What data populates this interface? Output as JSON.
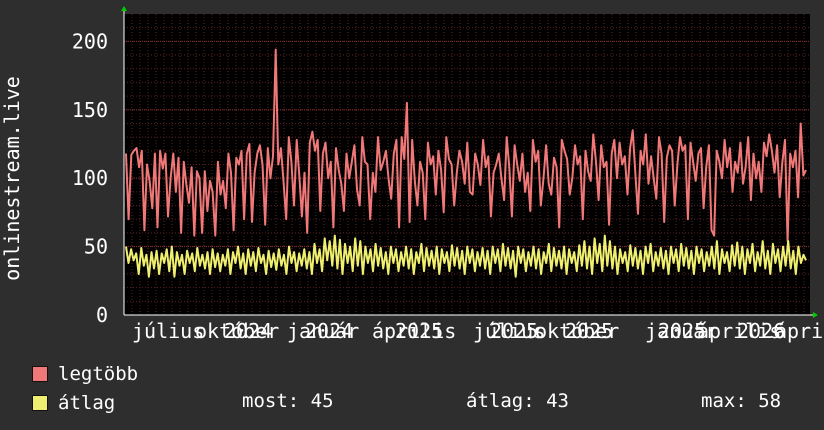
{
  "chart_data": {
    "type": "line",
    "ylabel": "onlinestream.live",
    "ylim": [
      0,
      220
    ],
    "y_ticks": [
      0,
      50,
      100,
      150,
      200
    ],
    "x_tick_labels": [
      "július",
      "október",
      "2024",
      "január",
      "2024",
      "április",
      "2025",
      "július",
      "2025",
      "október",
      "2025",
      "január",
      "2025",
      "április",
      "2026",
      "április"
    ],
    "grid": true,
    "legend_position": "bottom-left",
    "colors": {
      "background": "#2e2e2e",
      "plot_area": "#000000",
      "grid": "#5a2020",
      "axis": "#ffffff",
      "text": "#ffffff",
      "legtobb": "#f07878",
      "atlag": "#f0f070"
    },
    "series": [
      {
        "name": "legtöbb",
        "values": [
          118,
          70,
          117,
          120,
          122,
          108,
          120,
          62,
          110,
          98,
          78,
          118,
          64,
          120,
          107,
          118,
          72,
          100,
          118,
          90,
          115,
          60,
          112,
          95,
          82,
          108,
          58,
          105,
          100,
          60,
          105,
          76,
          98,
          90,
          58,
          112,
          88,
          98,
          78,
          118,
          104,
          62,
          115,
          110,
          120,
          70,
          118,
          125,
          68,
          104,
          118,
          124,
          110,
          66,
          122,
          100,
          116,
          194,
          110,
          122,
          98,
          70,
          130,
          112,
          80,
          128,
          102,
          72,
          104,
          60,
          126,
          134,
          120,
          128,
          76,
          118,
          126,
          100,
          112,
          64,
          122,
          106,
          96,
          76,
          118,
          100,
          112,
          124,
          92,
          80,
          130,
          112,
          110,
          70,
          104,
          90,
          130,
          106,
          112,
          120,
          100,
          85,
          118,
          128,
          64,
          130,
          114,
          155,
          68,
          128,
          98,
          80,
          112,
          104,
          70,
          126,
          110,
          116,
          88,
          120,
          106,
          75,
          130,
          114,
          110,
          80,
          104,
          120,
          112,
          96,
          126,
          90,
          88,
          118,
          110,
          95,
          128,
          108,
          116,
          72,
          104,
          110,
          118,
          100,
          84,
          130,
          108,
          72,
          124,
          110,
          98,
          118,
          90,
          104,
          76,
          128,
          112,
          120,
          80,
          100,
          124,
          96,
          88,
          115,
          108,
          64,
          128,
          120,
          114,
          88,
          100,
          124,
          110,
          116,
          70,
          120,
          105,
          98,
          132,
          112,
          84,
          124,
          108,
          112,
          66,
          118,
          128,
          100,
          126,
          110,
          116,
          88,
          122,
          135,
          104,
          74,
          120,
          110,
          132,
          96,
          116,
          100,
          85,
          130,
          118,
          68,
          115,
          124,
          120,
          80,
          110,
          130,
          120,
          124,
          70,
          126,
          112,
          98,
          118,
          122,
          78,
          108,
          124,
          62,
          58,
          120,
          112,
          100,
          128,
          108,
          122,
          90,
          112,
          104,
          126,
          96,
          108,
          130,
          84,
          118,
          100,
          112,
          90,
          126,
          116,
          132,
          120,
          104,
          124,
          86,
          112,
          128,
          54,
          118,
          108,
          120,
          86,
          140,
          102,
          106
        ]
      },
      {
        "name": "átlag",
        "values": [
          50,
          38,
          48,
          40,
          45,
          30,
          49,
          36,
          44,
          28,
          46,
          34,
          47,
          30,
          45,
          38,
          48,
          32,
          50,
          28,
          46,
          36,
          44,
          30,
          47,
          38,
          45,
          32,
          49,
          36,
          44,
          34,
          46,
          30,
          48,
          35,
          45,
          32,
          44,
          36,
          48,
          30,
          46,
          38,
          50,
          34,
          45,
          30,
          48,
          36,
          46,
          32,
          49,
          38,
          44,
          30,
          47,
          35,
          45,
          33,
          48,
          36,
          44,
          30,
          50,
          38,
          46,
          32,
          45,
          36,
          48,
          34,
          46,
          30,
          52,
          38,
          48,
          32,
          56,
          40,
          54,
          36,
          58,
          34,
          55,
          30,
          52,
          38,
          50,
          32,
          56,
          36,
          54,
          30,
          50,
          38,
          48,
          32,
          52,
          36,
          49,
          34,
          46,
          30,
          50,
          38,
          48,
          32,
          46,
          36,
          50,
          34,
          48,
          30,
          46,
          38,
          52,
          32,
          49,
          36,
          47,
          34,
          50,
          30,
          48,
          38,
          46,
          32,
          51,
          36,
          49,
          34,
          47,
          30,
          50,
          38,
          48,
          32,
          46,
          36,
          49,
          34,
          47,
          30,
          50,
          38,
          48,
          32,
          52,
          36,
          49,
          34,
          47,
          28,
          50,
          38,
          48,
          32,
          46,
          36,
          50,
          34,
          48,
          30,
          46,
          38,
          52,
          32,
          49,
          36,
          47,
          34,
          50,
          30,
          48,
          38,
          46,
          32,
          51,
          36,
          54,
          34,
          50,
          30,
          56,
          38,
          52,
          32,
          58,
          36,
          54,
          34,
          50,
          30,
          48,
          38,
          46,
          32,
          51,
          36,
          49,
          34,
          47,
          30,
          50,
          38,
          52,
          32,
          46,
          36,
          49,
          34,
          47,
          30,
          50,
          38,
          48,
          32,
          52,
          36,
          49,
          34,
          47,
          30,
          50,
          38,
          48,
          32,
          46,
          36,
          50,
          34,
          54,
          30,
          48,
          38,
          46,
          32,
          51,
          36,
          53,
          34,
          50,
          30,
          48,
          38,
          52,
          32,
          46,
          36,
          54,
          34,
          47,
          30,
          52,
          38,
          48,
          32,
          50,
          36,
          54,
          34,
          47,
          30,
          50,
          38,
          44,
          40
        ]
      }
    ]
  },
  "legend": {
    "items": [
      {
        "label": "legtöbb",
        "color": "#f07878"
      },
      {
        "label": "átlag",
        "color": "#f0f070"
      }
    ]
  },
  "stats": {
    "most": "most: 45",
    "atlag": "átlag: 43",
    "max": "max: 58"
  }
}
